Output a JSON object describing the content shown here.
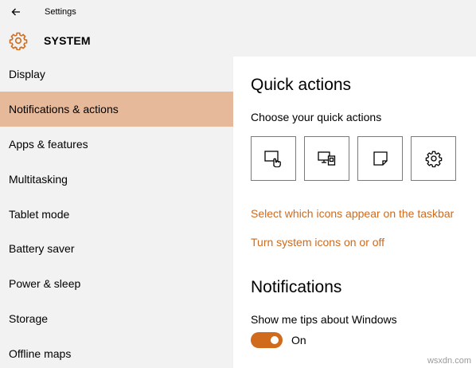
{
  "window": {
    "title": "Settings"
  },
  "header": {
    "section": "SYSTEM",
    "accent": "#d06a1c"
  },
  "sidebar": {
    "selected_bg": "#e6b99a",
    "items": [
      {
        "label": "Display"
      },
      {
        "label": "Notifications & actions"
      },
      {
        "label": "Apps & features"
      },
      {
        "label": "Multitasking"
      },
      {
        "label": "Tablet mode"
      },
      {
        "label": "Battery saver"
      },
      {
        "label": "Power & sleep"
      },
      {
        "label": "Storage"
      },
      {
        "label": "Offline maps"
      }
    ]
  },
  "main": {
    "quick_actions_title": "Quick actions",
    "quick_actions_subtitle": "Choose your quick actions",
    "tiles": [
      {
        "icon": "tablet-mode-icon"
      },
      {
        "icon": "project-icon"
      },
      {
        "icon": "note-icon"
      },
      {
        "icon": "settings-icon"
      }
    ],
    "link_taskbar_icons": "Select which icons appear on the taskbar",
    "link_system_icons": "Turn system icons on or off",
    "notifications_title": "Notifications",
    "tips_label": "Show me tips about Windows",
    "tips_state": "On"
  },
  "watermark": "wsxdn.com"
}
